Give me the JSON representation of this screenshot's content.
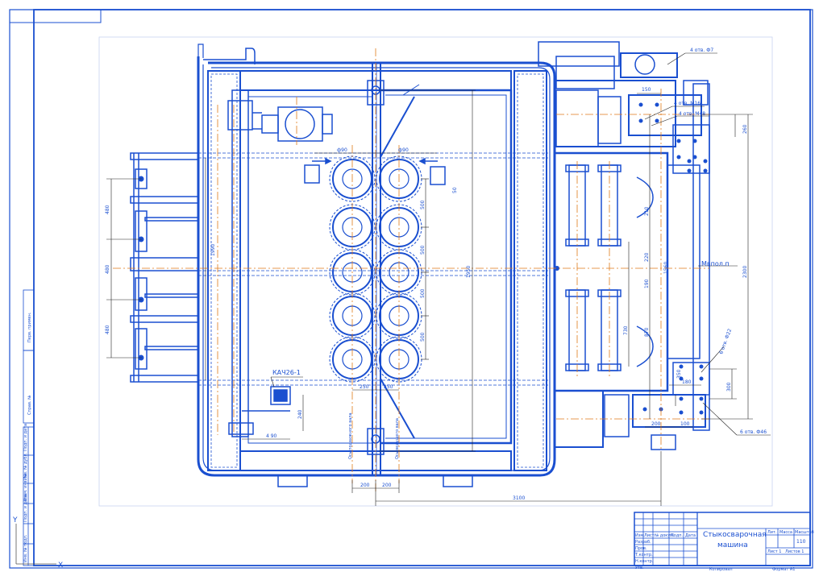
{
  "colors": {
    "line": "#1a4fd0",
    "axis": "#e07a1a",
    "bg": "#ffffff",
    "paper": "#ffffff"
  },
  "drawing": {
    "title_line1": "Стыкосварочная",
    "title_line2": "машина",
    "sheet_code": "110",
    "sheet_label": "Лист 1",
    "sheets_label": "Листов 1",
    "scale_label": "Масштаб",
    "mass_label": "Масса",
    "lit_label": "Лит.",
    "format_label": "Формат А1",
    "copied_label": "Копировал",
    "left_stamp_1": "Перв. примен.",
    "left_stamp_2": "Справ. №",
    "left_stamp_3": "Подп. и дата",
    "left_stamp_4": "Инв. № дубл.",
    "left_stamp_5": "Взам. инв. №",
    "left_stamp_6": "Подп. и дата",
    "left_stamp_7": "Инв. № подл.",
    "block_rows": [
      "Изм.",
      "Лист",
      "№ докум.",
      "Подп.",
      "Дата"
    ],
    "block_people": [
      "Разраб.",
      "Пров.",
      "Т.контр.",
      "Н.контр.",
      "Утв."
    ]
  },
  "annotations": {
    "kanch": "КАЧ26-1",
    "bolt_top": "4 отв. Ф7",
    "bolt_m16": "4 отв. М16",
    "bolt_m48": "4 отв. М48",
    "bolt_d22": "6 отв. Ф22",
    "bolt_d46": "6 отв. Ф46",
    "mvpolp": "Мвпол.п",
    "vertical_a": "Ось подвижного вала",
    "vertical_b": "Ось ведущего вала"
  },
  "dimensions": {
    "d_3100": "3100",
    "d_200a": "200",
    "d_200b": "200",
    "d_250a": "250",
    "d_250b": "250",
    "d_1950": "1950",
    "d_1560": "1560",
    "d_1990": "1990",
    "d_480a": "480",
    "d_480b": "480",
    "d_480c": "480",
    "d_490a": "ф90",
    "d_490b": "ф90",
    "d_500a": "500",
    "d_500b": "500",
    "d_500c": "500",
    "d_500d": "500",
    "d_150": "150",
    "d_240": "240",
    "d_180": "180",
    "d_730": "730",
    "d_870": "870",
    "d_210": "210",
    "d_220": "220",
    "d_190": "190",
    "d_200c": "200",
    "d_350": "350",
    "d_2300": "2300",
    "d_260": "260",
    "d_300": "300",
    "d_100": "100",
    "d_1060": "1060",
    "d_390": "390",
    "d_4x90": "4 90",
    "d_50": "50"
  },
  "axis_markers": {
    "y": "Y",
    "x": "X"
  }
}
